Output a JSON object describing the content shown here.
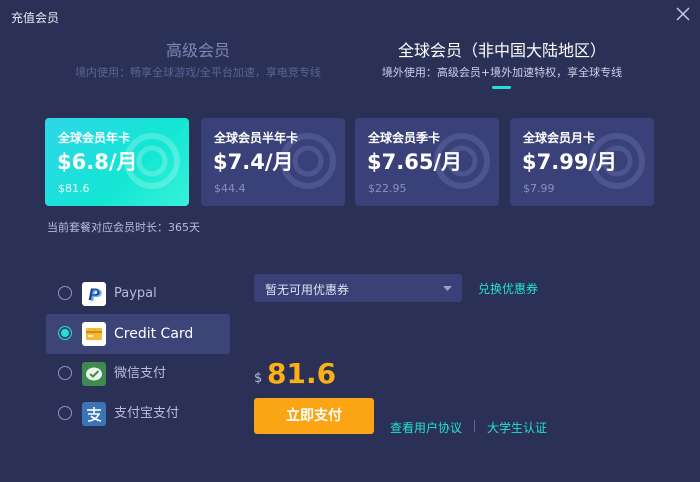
{
  "window": {
    "title": "充值会员"
  },
  "tabs": [
    {
      "title": "高级会员",
      "desc": "境内使用：畅享全球游戏/全平台加速，享电竞专线",
      "active": false
    },
    {
      "title": "全球会员（非中国大陆地区）",
      "desc": "境外使用：高级会员+境外加速特权，享全球专线",
      "active": true
    }
  ],
  "plans": [
    {
      "name": "全球会员年卡",
      "price": "$6.8/月",
      "total": "$81.6",
      "selected": true
    },
    {
      "name": "全球会员半年卡",
      "price": "$7.4/月",
      "total": "$44.4",
      "selected": false
    },
    {
      "name": "全球会员季卡",
      "price": "$7.65/月",
      "total": "$22.95",
      "selected": false
    },
    {
      "name": "全球会员月卡",
      "price": "$7.99/月",
      "total": "$7.99",
      "selected": false
    }
  ],
  "duration_note": "当前套餐对应会员时长：365天",
  "payment_methods": [
    {
      "label": "Paypal",
      "icon": "paypal-icon",
      "selected": false
    },
    {
      "label": "Credit Card",
      "icon": "credit-card-icon",
      "selected": true
    },
    {
      "label": "微信支付",
      "icon": "wechat-pay-icon",
      "selected": false
    },
    {
      "label": "支付宝支付",
      "icon": "alipay-icon",
      "selected": false
    }
  ],
  "coupon": {
    "value": "暂无可用优惠券",
    "redeem_label": "兑换优惠券"
  },
  "total": {
    "currency": "$",
    "amount": "81.6"
  },
  "actions": {
    "pay_label": "立即支付",
    "agreement_label": "查看用户协议",
    "student_label": "大学生认证"
  },
  "colors": {
    "background": "#2b3056",
    "accent": "#23e1cf",
    "price": "#fbb016",
    "button": "#fba414",
    "card": "#3a4078"
  }
}
